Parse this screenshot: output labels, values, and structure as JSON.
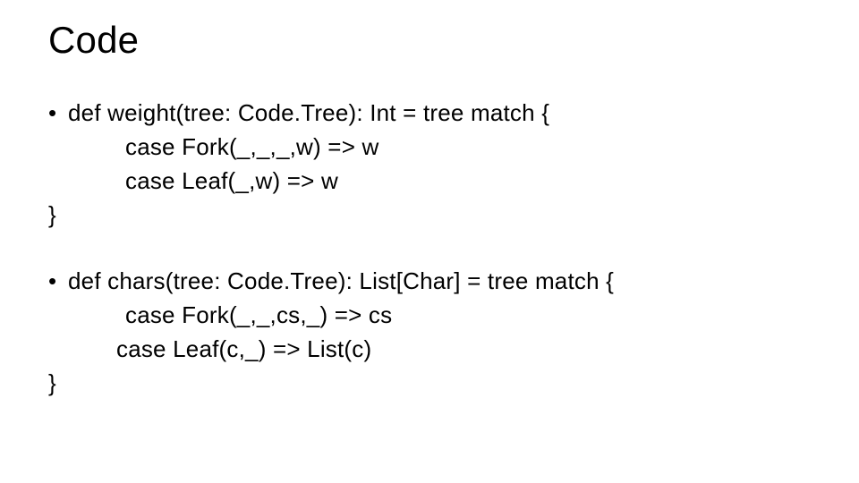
{
  "title": "Code",
  "blocks": [
    {
      "bullet": "•",
      "first_line": "def weight(tree: Code.Tree): Int = tree match {",
      "lines": [
        {
          "cls": "indent1",
          "text": "case Fork(_,_,_,w) => w"
        },
        {
          "cls": "indent1",
          "text": "case Leaf(_,w) => w"
        }
      ],
      "close": "}"
    },
    {
      "bullet": "•",
      "first_line": "def chars(tree: Code.Tree): List[Char] = tree match {",
      "lines": [
        {
          "cls": "indent1",
          "text": "case Fork(_,_,cs,_) => cs"
        },
        {
          "cls": "indent1b",
          "text": "case Leaf(c,_) => List(c)"
        }
      ],
      "close": "}"
    }
  ]
}
